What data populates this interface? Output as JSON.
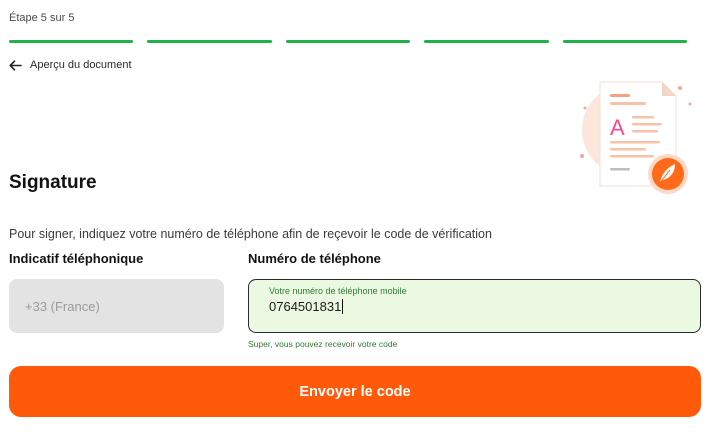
{
  "stepper": {
    "label": "Étape 5 sur 5",
    "total_steps": 5,
    "completed_steps": 5,
    "color": "#21b14b"
  },
  "nav": {
    "back_label": "Aperçu du document",
    "back_icon": "arrow-left-icon"
  },
  "illustration": {
    "letter": "A",
    "icon": "document-with-feather-icon"
  },
  "heading": "Signature",
  "description": "Pour signer, indiquez votre numéro de téléphone afin de reçevoir le code de vérification",
  "form": {
    "prefix_label": "Indicatif téléphonique",
    "prefix_value": "+33 (France)",
    "phone_label": "Numéro de téléphone",
    "phone_floating_label": "Votre numéro de téléphone mobile",
    "phone_value": "0764501831",
    "phone_helper": "Super, vous pouvez recevoir votre code",
    "valid_color": "#ebf9e2"
  },
  "submit": {
    "label": "Envoyer le code",
    "color": "#ff5a0a"
  }
}
